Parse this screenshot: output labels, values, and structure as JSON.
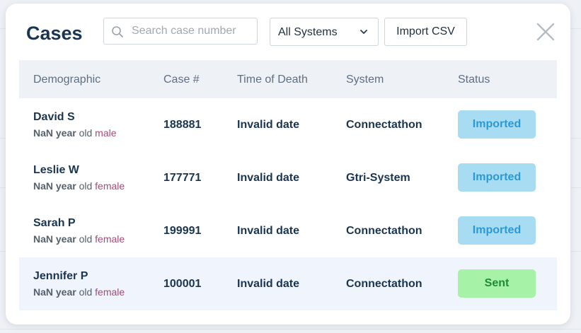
{
  "modal": {
    "title": "Cases",
    "search": {
      "placeholder": "Search case number",
      "value": ""
    },
    "system_filter": {
      "selected": "All Systems"
    },
    "import_label": "Import CSV"
  },
  "table": {
    "headers": [
      "Demographic",
      "Case #",
      "Time of Death",
      "System",
      "Status"
    ],
    "rows": [
      {
        "name": "David S",
        "age": "NaN year",
        "old": "old",
        "sex": "male",
        "case": "188881",
        "tod": "Invalid date",
        "system": "Connectathon",
        "status": "Imported"
      },
      {
        "name": "Leslie W",
        "age": "NaN year",
        "old": "old",
        "sex": "female",
        "case": "177771",
        "tod": "Invalid date",
        "system": "Gtri-System",
        "status": "Imported"
      },
      {
        "name": "Sarah P",
        "age": "NaN year",
        "old": "old",
        "sex": "female",
        "case": "199991",
        "tod": "Invalid date",
        "system": "Connectathon",
        "status": "Imported"
      },
      {
        "name": "Jennifer P",
        "age": "NaN year",
        "old": "old",
        "sex": "female",
        "case": "100001",
        "tod": "Invalid date",
        "system": "Connectathon",
        "status": "Sent"
      }
    ]
  },
  "colors": {
    "imported_bg": "#a8dcf2",
    "imported_fg": "#2a9ad6",
    "sent_bg": "#a6f2a6",
    "sent_fg": "#1f8a3a",
    "title": "#1a3552",
    "sex_text": "#a8497c"
  },
  "icons": {
    "search": "search-icon",
    "dropdown": "chevron-down-icon",
    "close": "close-icon"
  }
}
